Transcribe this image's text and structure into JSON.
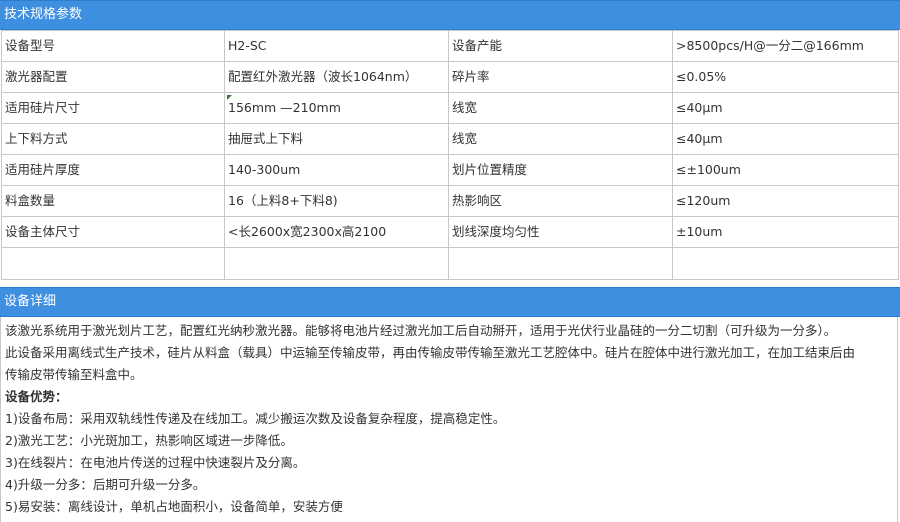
{
  "spec_section": {
    "title": "技术规格参数"
  },
  "spec_rows": [
    [
      "设备型号",
      "H2-SC",
      "设备产能",
      ">8500pcs/H@一分二@166mm"
    ],
    [
      "激光器配置",
      "配置红外激光器（波长1064nm）",
      "碎片率",
      "≤0.05%"
    ],
    [
      "适用硅片尺寸",
      "156mm —210mm",
      "线宽",
      "≤40μm"
    ],
    [
      "上下料方式",
      "抽屉式上下料",
      "线宽",
      "≤40μm"
    ],
    [
      "适用硅片厚度",
      "140-300um",
      "划片位置精度",
      "≤±100um"
    ],
    [
      "料盒数量",
      "16（上料8+下料8)",
      "热影响区",
      "≤120um"
    ],
    [
      "设备主体尺寸",
      "<长2600x宽2300x高2100",
      "划线深度均匀性",
      "±10um"
    ]
  ],
  "details_section": {
    "title": "设备详细",
    "paragraphs": [
      "该激光系统用于激光划片工艺，配置红光纳秒激光器。能够将电池片经过激光加工后自动掰开，适用于光伏行业晶硅的一分二切割（可升级为一分多）。",
      "此设备采用离线式生产技术，硅片从料盒（载具）中运输至传输皮带，再由传输皮带传输至激光工艺腔体中。硅片在腔体中进行激光加工，在加工结束后由",
      "传输皮带传输至料盒中。"
    ],
    "advantages_title": "设备优势：",
    "advantages": [
      "1)设备布局：采用双轨线性传递及在线加工。减少搬运次数及设备复杂程度，提高稳定性。",
      "2)激光工艺：小光斑加工，热影响区域进一步降低。",
      "3)在线裂片：在电池片传送的过程中快速裂片及分离。",
      "4)升级一分多：后期可升级一分多。",
      "5)易安装：离线设计，单机占地面积小，设备简单，安装方便"
    ]
  },
  "colors": {
    "header_bg": "#3f8fe0",
    "header_text": "#ffffff",
    "border": "#c8c8c8",
    "text": "#333333"
  }
}
